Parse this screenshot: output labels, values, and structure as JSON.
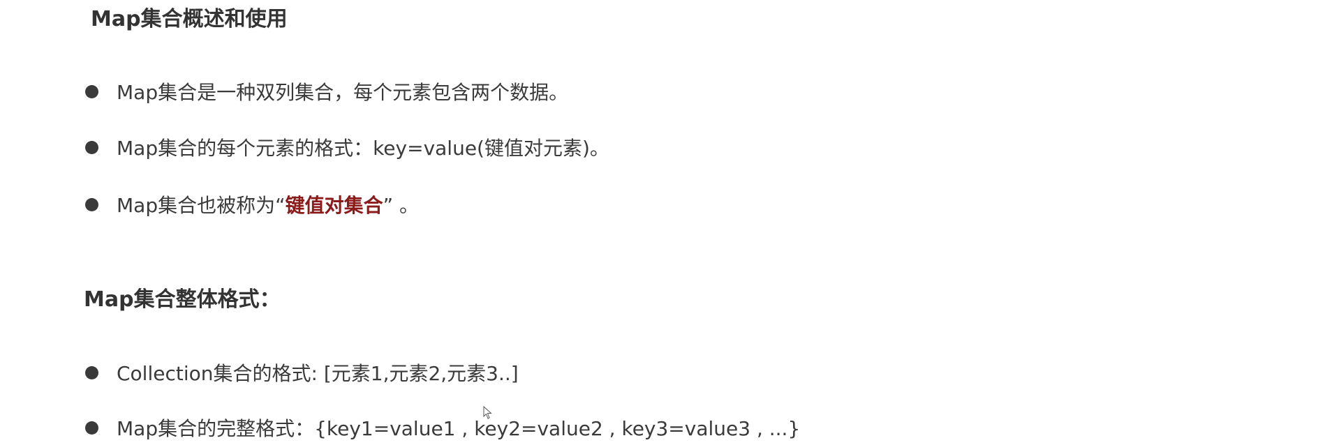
{
  "title": "Map集合概述和使用",
  "intro_items": [
    {
      "text": "Map集合是一种双列集合，每个元素包含两个数据。"
    },
    {
      "text": "Map集合的每个元素的格式：key=value(键值对元素)。"
    },
    {
      "prefix": "Map集合也被称为“",
      "highlight": "键值对集合",
      "suffix": "” 。"
    }
  ],
  "format_heading": "Map集合整体格式：",
  "format_items": [
    {
      "text": "Collection集合的格式: [元素1,元素2,元素3..]"
    },
    {
      "text": "Map集合的完整格式：{key1=value1 , key2=value2 , key3=value3 , ...}"
    }
  ],
  "colors": {
    "highlight": "#8b1a1a",
    "text": "#3a3a3a"
  }
}
